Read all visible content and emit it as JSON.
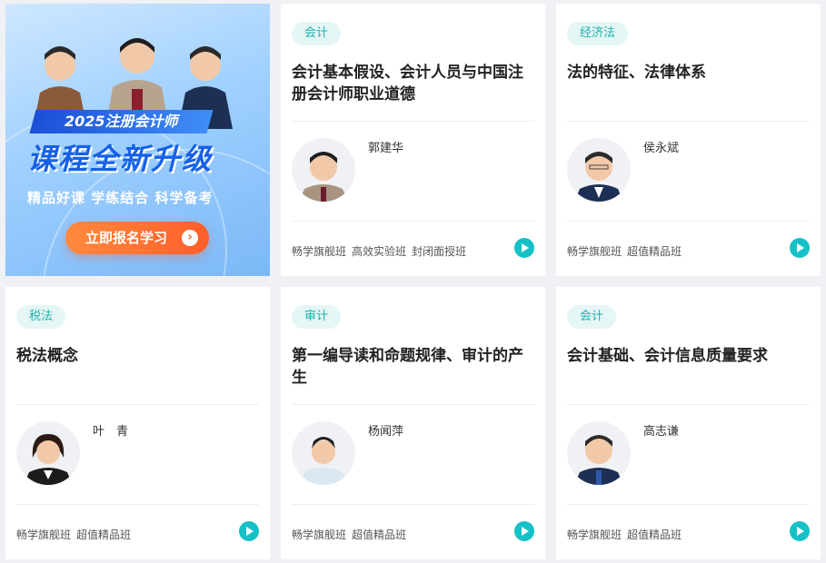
{
  "banner": {
    "ribbon": "2025注册会计师",
    "headline": "课程全新升级",
    "subtitle": "精品好课  学练结合  科学备考",
    "button": "立即报名学习"
  },
  "courses": [
    {
      "tag": "会计",
      "title": "会计基本假设、会计人员与中国注册会计师职业道德",
      "teacher": "郭建华",
      "classes": [
        "畅学旗舰班",
        "高效实验班",
        "封闭面授班"
      ]
    },
    {
      "tag": "经济法",
      "title": "法的特征、法律体系",
      "teacher": "侯永斌",
      "classes": [
        "畅学旗舰班",
        "超值精品班"
      ]
    },
    {
      "tag": "税法",
      "title": "税法概念",
      "teacher": "叶　青",
      "classes": [
        "畅学旗舰班",
        "超值精品班"
      ]
    },
    {
      "tag": "审计",
      "title": "第一编导读和命题规律、审计的产生",
      "teacher": "杨闻萍",
      "classes": [
        "畅学旗舰班",
        "超值精品班"
      ]
    },
    {
      "tag": "会计",
      "title": "会计基础、会计信息质量要求",
      "teacher": "高志谦",
      "classes": [
        "畅学旗舰班",
        "超值精品班"
      ]
    }
  ]
}
